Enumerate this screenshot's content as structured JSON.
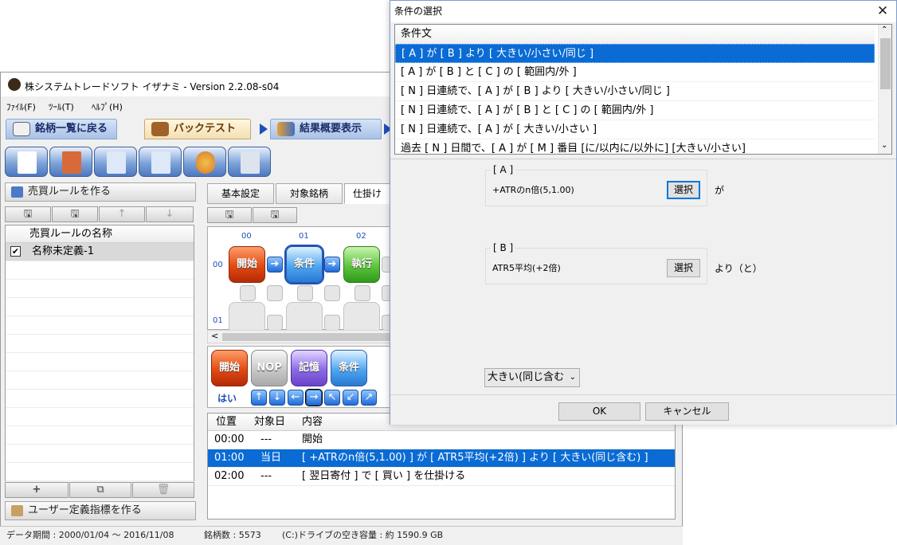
{
  "main_window": {
    "title": "株システムトレードソフト イザナミ - Version 2.2.08-s04",
    "menu": [
      "ﾌｧｲﾙ(F)",
      "ﾂｰﾙ(T)",
      "ﾍﾙﾌﾟ(H)"
    ],
    "tabs": [
      {
        "label": "銘柄一覧に戻る"
      },
      {
        "label": "バックテスト"
      },
      {
        "label": "結果概要表示"
      }
    ],
    "left_panel": {
      "header": "売買ルールを作る",
      "grid_header": "売買ルールの名称",
      "rows": [
        {
          "checked": true,
          "name": "名称未定義-1"
        }
      ],
      "footer": "ユーザー定義指標を作る"
    },
    "subtabs": [
      "基本設定",
      "対象銘柄",
      "仕掛け"
    ],
    "flow": {
      "col_labels": [
        "00",
        "01",
        "02"
      ],
      "row_labels": [
        "00",
        "01"
      ],
      "boxes": [
        "開始",
        "条件",
        "執行"
      ]
    },
    "palette": {
      "items": [
        "開始",
        "NOP",
        "記憶",
        "条件"
      ],
      "yes_label": "はい"
    },
    "bottom_grid": {
      "headers": [
        "位置",
        "対象日",
        "内容"
      ],
      "rows": [
        {
          "pos": "00:00",
          "day": "---",
          "content": "開始"
        },
        {
          "pos": "01:00",
          "day": "当日",
          "content": "[ +ATRのn倍(5,1.00) ] が [ ATR5平均(+2倍) ] より [ 大きい(同じ含む) ]"
        },
        {
          "pos": "02:00",
          "day": "---",
          "content": "[ 翌日寄付 ] で [ 買い ] を仕掛ける"
        }
      ]
    },
    "status": {
      "period": "データ期間 : 2000/01/04 ～ 2016/11/08",
      "count": "銘柄数 : 5573",
      "disk": "(C:)ドライブの空き容量 : 約 1590.9 GB"
    }
  },
  "dialog": {
    "title": "条件の選択",
    "list_header": "条件文",
    "items": [
      "[ A ] が [ B ] より [ 大きい/小さい/同じ ]",
      "[ A ] が [ B ] と [ C ] の [ 範囲内/外 ]",
      "[ N ] 日連続で、[ A ] が [ B ] より [ 大きい/小さい/同じ ]",
      "[ N ] 日連続で、[ A ] が [ B ] と [ C ] の [ 範囲内/外 ]",
      "[ N ] 日連続で、[ A ] が [ 大きい/小さい ]",
      "過去 [ N ] 日間で、[ A ] が [ M ] 番目 [に/以内に/以外に] [大きい/小さい]"
    ],
    "selected_index": 0,
    "group_a": {
      "label": "[ A ]",
      "value": "+ATRのn倍(5,1.00)",
      "button": "選択",
      "suffix": "が"
    },
    "group_b": {
      "label": "[ B ]",
      "value": "ATR5平均(+2倍)",
      "button": "選択",
      "suffix": "より（と）"
    },
    "compare": "大きい(同じ含む",
    "ok": "OK",
    "cancel": "キャンセル"
  }
}
